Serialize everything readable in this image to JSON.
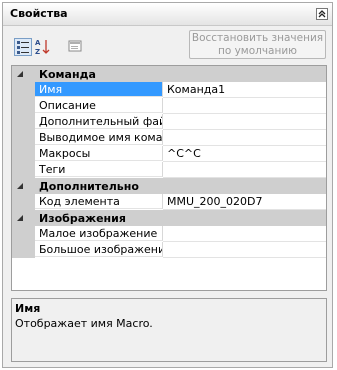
{
  "panel": {
    "title": "Свойства"
  },
  "toolbar": {
    "restore_label_line1": "Восстановить значения",
    "restore_label_line2": "по умолчанию"
  },
  "grid": {
    "categories": [
      {
        "name": "Команда",
        "props": [
          {
            "name": "Имя",
            "value": "Команда1"
          },
          {
            "name": "Описание",
            "value": ""
          },
          {
            "name": "Дополнительный файл с",
            "value": ""
          },
          {
            "name": "Выводимое имя команд",
            "value": ""
          },
          {
            "name": "Макросы",
            "value": "^C^C"
          },
          {
            "name": "Теги",
            "value": ""
          }
        ]
      },
      {
        "name": "Дополнительно",
        "props": [
          {
            "name": "Код элемента",
            "value": "MMU_200_020D7"
          }
        ]
      },
      {
        "name": "Изображения",
        "props": [
          {
            "name": "Малое изображение",
            "value": ""
          },
          {
            "name": "Большое изображение",
            "value": ""
          }
        ]
      }
    ]
  },
  "description": {
    "title": "Имя",
    "text": "Отображает имя Macro."
  }
}
